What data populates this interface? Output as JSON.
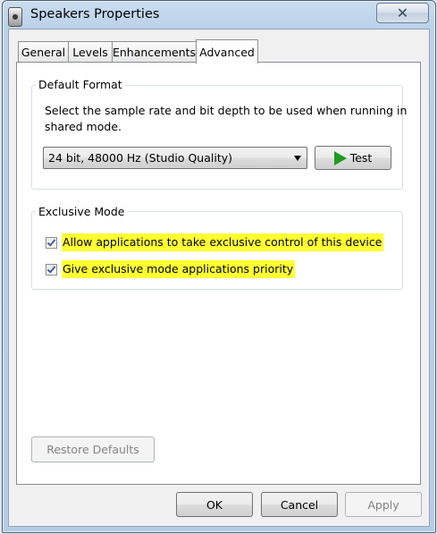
{
  "window": {
    "title": "Speakers Properties",
    "close_glyph": "✕"
  },
  "tabs": [
    {
      "label": "General"
    },
    {
      "label": "Levels"
    },
    {
      "label": "Enhancements"
    },
    {
      "label": "Advanced",
      "selected": true
    }
  ],
  "default_format": {
    "group_label": "Default Format",
    "description_line1": "Select the sample rate and bit depth to be used when running in",
    "description_line2": "shared mode.",
    "selected_format": "24 bit, 48000 Hz (Studio Quality)",
    "test_label": "Test"
  },
  "exclusive_mode": {
    "group_label": "Exclusive Mode",
    "options": [
      {
        "label": "Allow applications to take exclusive control of this device",
        "checked": true
      },
      {
        "label": "Give exclusive mode applications priority",
        "checked": true
      }
    ],
    "highlight_color": "#ffff33"
  },
  "restore_defaults_label": "Restore Defaults",
  "footer": {
    "ok_label": "OK",
    "cancel_label": "Cancel",
    "apply_label": "Apply"
  },
  "icons": {
    "app": "speaker-icon",
    "play": "play-icon"
  },
  "colors": {
    "play_green": "#1f9a1f",
    "disabled_text": "#838383"
  }
}
